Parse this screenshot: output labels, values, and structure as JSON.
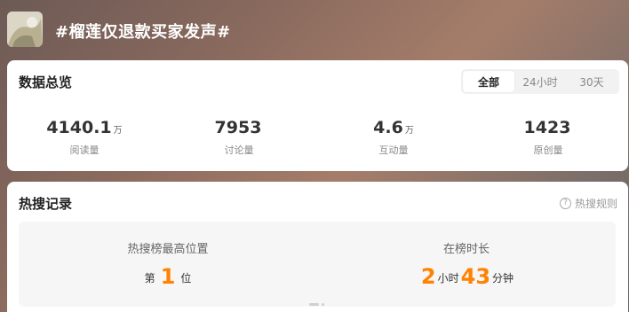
{
  "topic": {
    "title": "#榴莲仅退款买家发声#"
  },
  "overview": {
    "title": "数据总览",
    "tabs": [
      {
        "label": "全部",
        "active": true
      },
      {
        "label": "24小时",
        "active": false
      },
      {
        "label": "30天",
        "active": false
      }
    ],
    "stats": [
      {
        "value": "4140.1",
        "unit": "万",
        "label": "阅读量"
      },
      {
        "value": "7953",
        "unit": "",
        "label": "讨论量"
      },
      {
        "value": "4.6",
        "unit": "万",
        "label": "互动量"
      },
      {
        "value": "1423",
        "unit": "",
        "label": "原创量"
      }
    ]
  },
  "hot_search": {
    "title": "热搜记录",
    "rules_label": "热搜规则",
    "peak": {
      "heading": "热搜榜最高位置",
      "prefix": "第",
      "value": "1",
      "suffix": "位"
    },
    "duration": {
      "heading": "在榜时长",
      "hours": "2",
      "hours_unit": "小时",
      "minutes": "43",
      "minutes_unit": "分钟"
    }
  },
  "colors": {
    "accent": "#ff8200",
    "text_primary": "#333333",
    "text_secondary": "#888888"
  }
}
